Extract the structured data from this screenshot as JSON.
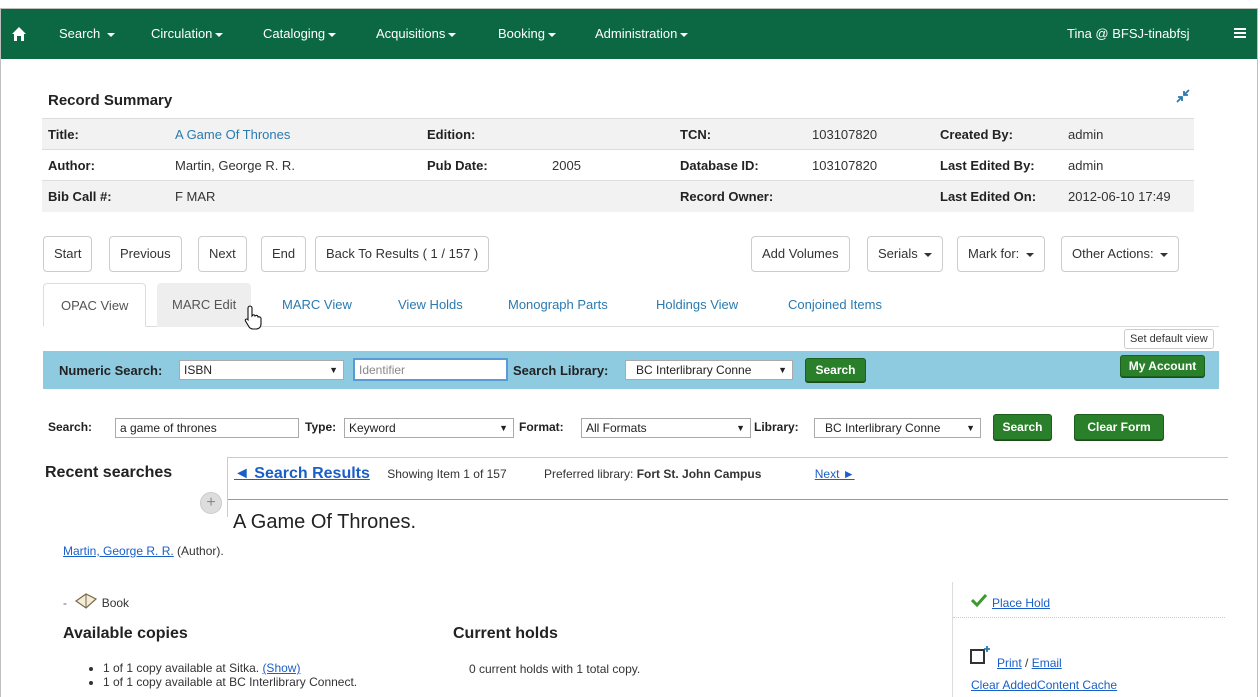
{
  "navbar": {
    "menus": [
      "Search",
      "Circulation",
      "Cataloging",
      "Acquisitions",
      "Booking",
      "Administration"
    ],
    "user": "Tina @ BFSJ-tinabfsj"
  },
  "record_summary": {
    "title": "Record Summary",
    "rows": [
      [
        {
          "label": "Title:",
          "value": "A Game Of Thrones",
          "link": true
        },
        {
          "label": "Edition:",
          "value": ""
        },
        {
          "label": "TCN:",
          "value": "103107820"
        },
        {
          "label": "Created By:",
          "value": "admin"
        }
      ],
      [
        {
          "label": "Author:",
          "value": "Martin, George R. R."
        },
        {
          "label": "Pub Date:",
          "value": "2005"
        },
        {
          "label": "Database ID:",
          "value": "103107820"
        },
        {
          "label": "Last Edited By:",
          "value": "admin"
        }
      ],
      [
        {
          "label": "Bib Call #:",
          "value": "F MAR"
        },
        {
          "label": "",
          "value": ""
        },
        {
          "label": "Record Owner:",
          "value": ""
        },
        {
          "label": "Last Edited On:",
          "value": "2012-06-10 17:49"
        }
      ]
    ]
  },
  "nav_buttons": {
    "start": "Start",
    "previous": "Previous",
    "next": "Next",
    "end": "End",
    "back": "Back To Results ( 1 / 157 )",
    "add_volumes": "Add Volumes",
    "serials": "Serials",
    "mark_for": "Mark for:",
    "other_actions": "Other Actions:"
  },
  "tabs": [
    "OPAC View",
    "MARC Edit",
    "MARC View",
    "View Holds",
    "Monograph Parts",
    "Holdings View",
    "Conjoined Items"
  ],
  "set_default_view": "Set default view",
  "numeric_search": {
    "label": "Numeric Search:",
    "type": "ISBN",
    "placeholder": "Identifier",
    "library_label": "Search Library:",
    "library": "BC Interlibrary Conne",
    "search_button": "Search",
    "my_account": "My Account"
  },
  "search": {
    "label": "Search:",
    "query": "a game of thrones",
    "type_label": "Type:",
    "type": "Keyword",
    "format_label": "Format:",
    "format": "All Formats",
    "library_label": "Library:",
    "library": "BC Interlibrary Conne",
    "search_button": "Search",
    "clear_button": "Clear Form"
  },
  "results": {
    "recent_searches": "Recent searches",
    "back_link": "◄ Search Results",
    "showing": "Showing Item 1 of 157",
    "preferred_label": "Preferred library:",
    "preferred_value": "Fort St. John Campus",
    "next_link": "Next ►"
  },
  "record": {
    "title": "A Game Of Thrones.",
    "author_link": "Martin, George R. R.",
    "author_role": "(Author).",
    "format": "Book",
    "available_heading": "Available copies",
    "available": [
      {
        "text": "1 of 1 copy available at Sitka.",
        "link": "(Show)"
      },
      {
        "text": "1 of 1 copy available at BC Interlibrary Connect.",
        "link": ""
      }
    ],
    "holds_heading": "Current holds",
    "holds_text": "0 current holds with 1 total copy."
  },
  "sidebar": {
    "place_hold": "Place Hold",
    "print": "Print",
    "email": "Email",
    "clear_cache": "Clear AddedContent Cache"
  }
}
